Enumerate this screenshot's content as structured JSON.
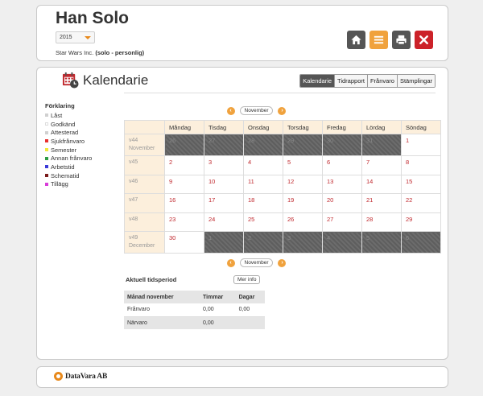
{
  "header": {
    "user_name": "Han Solo",
    "year": "2015",
    "company": "Star Wars Inc.",
    "company_detail": "(solo - personlig)"
  },
  "actions": {
    "home_icon": "home-icon",
    "menu_icon": "list-icon",
    "print_icon": "printer-icon",
    "close_icon": "close-icon"
  },
  "colors": {
    "accent": "#f0a23d",
    "close": "#cc2229",
    "dark_button": "#555555",
    "weekday_header": "#fcefdc",
    "day_number": "#c0282d"
  },
  "page": {
    "title": "Kalendarie",
    "tabs": [
      {
        "label": "Kalendarie",
        "active": true
      },
      {
        "label": "Tidrapport",
        "active": false
      },
      {
        "label": "Frånvaro",
        "active": false
      },
      {
        "label": "Stämplingar",
        "active": false
      }
    ]
  },
  "legend": {
    "title": "Förklaring",
    "items": [
      {
        "label": "Låst",
        "color": "#d0d0d0"
      },
      {
        "label": "Godkänd",
        "color": "#ffffff"
      },
      {
        "label": "Attesterad",
        "color": "#d0d0d0"
      },
      {
        "label": "Sjukfrånvaro",
        "color": "#e8302f"
      },
      {
        "label": "Semester",
        "color": "#f1e93b"
      },
      {
        "label": "Annan frånvaro",
        "color": "#2e9d45"
      },
      {
        "label": "Arbetstid",
        "color": "#3b3bd8"
      },
      {
        "label": "Schematid",
        "color": "#7a1a1a"
      },
      {
        "label": "Tillägg",
        "color": "#d93dd9"
      }
    ]
  },
  "month_nav": {
    "prev": "‹",
    "next": "›",
    "label": "November"
  },
  "calendar": {
    "weekdays": [
      "Måndag",
      "Tisdag",
      "Onsdag",
      "Torsdag",
      "Fredag",
      "Lördag",
      "Söndag"
    ],
    "weeks": [
      {
        "week": "v44",
        "month": "November",
        "days": [
          {
            "d": "26",
            "out": true
          },
          {
            "d": "27",
            "out": true
          },
          {
            "d": "28",
            "out": true
          },
          {
            "d": "29",
            "out": true
          },
          {
            "d": "30",
            "out": true
          },
          {
            "d": "31",
            "out": true
          },
          {
            "d": "1",
            "out": false
          }
        ]
      },
      {
        "week": "v45",
        "month": "",
        "days": [
          {
            "d": "2",
            "out": false
          },
          {
            "d": "3",
            "out": false
          },
          {
            "d": "4",
            "out": false
          },
          {
            "d": "5",
            "out": false
          },
          {
            "d": "6",
            "out": false
          },
          {
            "d": "7",
            "out": false
          },
          {
            "d": "8",
            "out": false
          }
        ]
      },
      {
        "week": "v46",
        "month": "",
        "days": [
          {
            "d": "9",
            "out": false
          },
          {
            "d": "10",
            "out": false
          },
          {
            "d": "11",
            "out": false
          },
          {
            "d": "12",
            "out": false
          },
          {
            "d": "13",
            "out": false
          },
          {
            "d": "14",
            "out": false
          },
          {
            "d": "15",
            "out": false
          }
        ]
      },
      {
        "week": "v47",
        "month": "",
        "days": [
          {
            "d": "16",
            "out": false
          },
          {
            "d": "17",
            "out": false
          },
          {
            "d": "18",
            "out": false
          },
          {
            "d": "19",
            "out": false
          },
          {
            "d": "20",
            "out": false
          },
          {
            "d": "21",
            "out": false
          },
          {
            "d": "22",
            "out": false
          }
        ]
      },
      {
        "week": "v48",
        "month": "",
        "days": [
          {
            "d": "23",
            "out": false
          },
          {
            "d": "24",
            "out": false
          },
          {
            "d": "25",
            "out": false
          },
          {
            "d": "26",
            "out": false
          },
          {
            "d": "27",
            "out": false
          },
          {
            "d": "28",
            "out": false
          },
          {
            "d": "29",
            "out": false
          }
        ]
      },
      {
        "week": "v49",
        "month": "December",
        "days": [
          {
            "d": "30",
            "out": false
          },
          {
            "d": "1",
            "out": true
          },
          {
            "d": "2",
            "out": true
          },
          {
            "d": "3",
            "out": true
          },
          {
            "d": "4",
            "out": true
          },
          {
            "d": "5",
            "out": true
          },
          {
            "d": "6",
            "out": true
          }
        ]
      }
    ]
  },
  "period": {
    "title": "Aktuell tidsperiod",
    "more_info": "Mer info",
    "columns": [
      "Månad november",
      "Timmar",
      "Dagar"
    ],
    "rows": [
      [
        "Frånvaro",
        "0,00",
        "0,00"
      ],
      [
        "Närvaro",
        "0,00",
        ""
      ]
    ]
  },
  "footer": {
    "logo_text": "DataVara AB"
  }
}
